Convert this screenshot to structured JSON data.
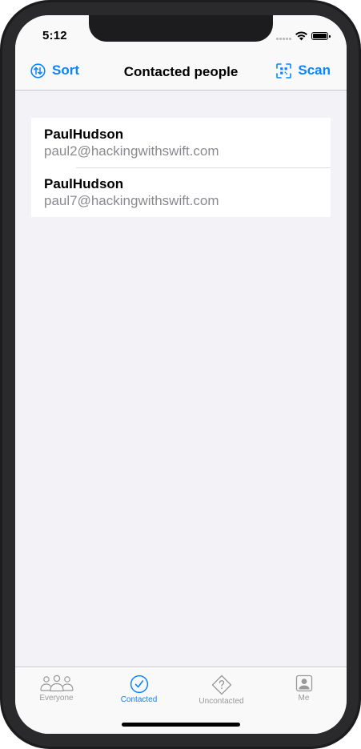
{
  "status_bar": {
    "time": "5:12"
  },
  "nav": {
    "title": "Contacted people",
    "sort_label": "Sort",
    "scan_label": "Scan",
    "accent_color": "#0a84ff"
  },
  "contacts": [
    {
      "name": "PaulHudson",
      "email": "paul2@hackingwithswift.com"
    },
    {
      "name": "PaulHudson",
      "email": "paul7@hackingwithswift.com"
    }
  ],
  "tabs": [
    {
      "label": "Everyone",
      "icon": "people-icon",
      "active": false
    },
    {
      "label": "Contacted",
      "icon": "checkmark-circle-icon",
      "active": true
    },
    {
      "label": "Uncontacted",
      "icon": "questionmark-diamond-icon",
      "active": false
    },
    {
      "label": "Me",
      "icon": "person-square-icon",
      "active": false
    }
  ]
}
